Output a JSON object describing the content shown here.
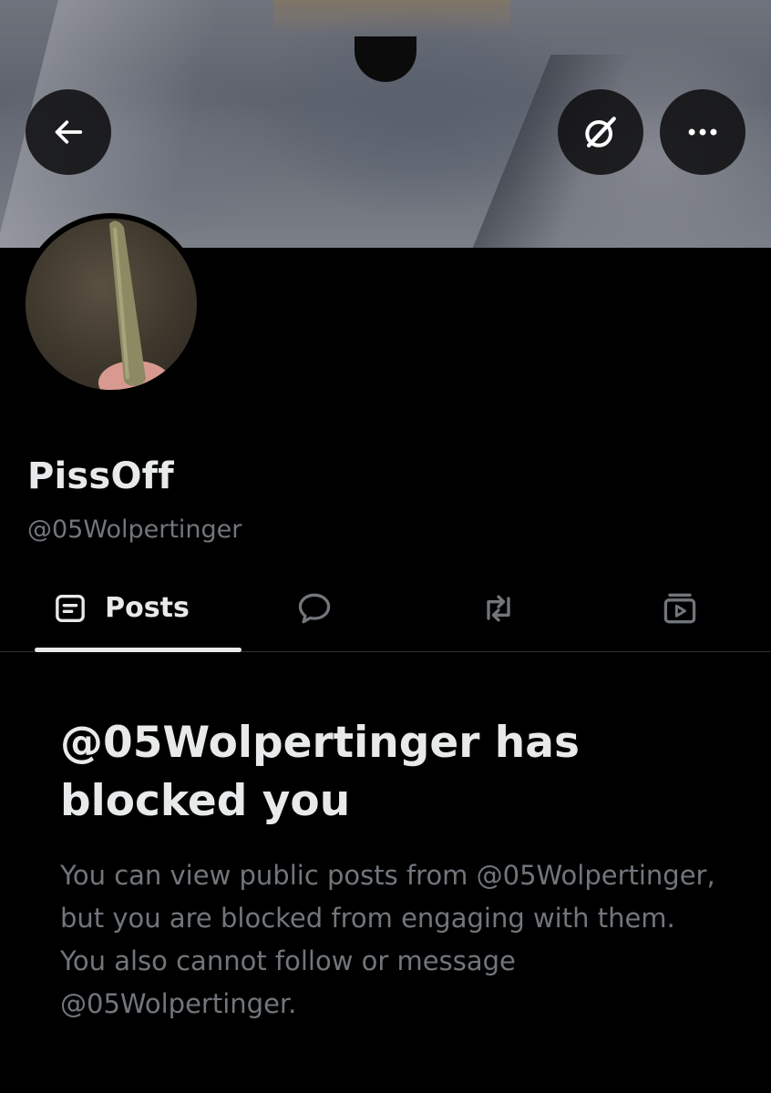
{
  "header": {
    "back_icon": "arrow-left-icon",
    "grok_icon": "grok-slash-icon",
    "more_icon": "ellipsis-horizontal-icon"
  },
  "profile": {
    "display_name": "PissOff",
    "handle": "@05Wolpertinger"
  },
  "tabs": [
    {
      "label": "Posts",
      "icon": "posts-icon",
      "selected": true
    },
    {
      "label": "",
      "icon": "reply-bubble-icon",
      "selected": false
    },
    {
      "label": "",
      "icon": "repost-icon",
      "selected": false
    },
    {
      "label": "",
      "icon": "media-icon",
      "selected": false
    }
  ],
  "blocked_notice": {
    "title": "@05Wolpertinger has blocked you",
    "body": "You can view public posts from @05Wolpertinger, but you are blocked from engaging with them. You also cannot follow or message @05Wolpertinger."
  },
  "colors": {
    "background": "#000000",
    "text_primary": "#e7e9ea",
    "text_secondary": "#71767b",
    "divider": "#2f3336"
  }
}
